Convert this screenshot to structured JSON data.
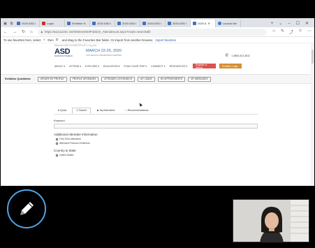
{
  "browser": {
    "tabs": [
      {
        "label": "2020 ASD I",
        "icon": "page-icon",
        "active": false
      },
      {
        "label": "Login",
        "icon": "login-icon",
        "active": false
      },
      {
        "label": "Exhibitor N",
        "icon": "page-icon",
        "active": false
      },
      {
        "label": "2020 ASD I",
        "icon": "page-icon",
        "active": false
      },
      {
        "label": "2020 ASD I",
        "icon": "page-icon",
        "active": false
      },
      {
        "label": "2020 ASD I",
        "icon": "page-icon",
        "active": false
      },
      {
        "label": "2020 ASD I",
        "icon": "page-icon",
        "active": false
      },
      {
        "label": "2020 A",
        "icon": "page-icon",
        "active": true
      },
      {
        "label": "Launch Me",
        "icon": "edge-icon",
        "active": false
      }
    ],
    "url": "https://asd.a2zinc.net/Winter2020/Public/e_AttendeeList.aspx?mode=search&lb",
    "favorites_text": "To see favorites here, select",
    "favorites_text2": "then",
    "favorites_text3": ", and drag to the Favorites Bar folder. Or import from another browser.",
    "favorites_link": "Import favorites"
  },
  "site": {
    "topstrip": "Welcome ASD EXHIBITOR LIST | Log Out",
    "logo_big": "ASD",
    "logo_small": "MARKETWEEK",
    "date": "MARCH 22-25, 2020",
    "venue": "LAS VEGAS CONVENTION CENTER",
    "phone": "1 (800) 421-4511",
    "nav": [
      "ABOUT ▾",
      "ATTEND ▾",
      "EXPLORE ▾",
      "EDUCATION ▾",
      "PLAN YOUR TRIP ▾",
      "CONNECT ▾",
      "RESOURCES ▾"
    ],
    "register_label": "Register to Attend",
    "login_label": "Exhibitor Login",
    "quicklinks_label": "Exhibitor Quicklinks",
    "quicklinks": [
      "UPDATE MY PROFILE",
      "PROFILE UPGRADES",
      "ATTENDEE LIST/SEARCH",
      "MY LEADS",
      "MY APPOINTMENTS",
      "MY MESSAGES"
    ]
  },
  "search": {
    "tabs": [
      "Quick",
      "Search",
      "My Attendees",
      "Recommendations"
    ],
    "keyword_label": "Keyword",
    "additional_label": "Additional Attendee Information",
    "checks": [
      "First Time Attendees",
      "Attended Previous Exhibitors"
    ],
    "country_label": "Country & State",
    "country_check": "United States"
  }
}
